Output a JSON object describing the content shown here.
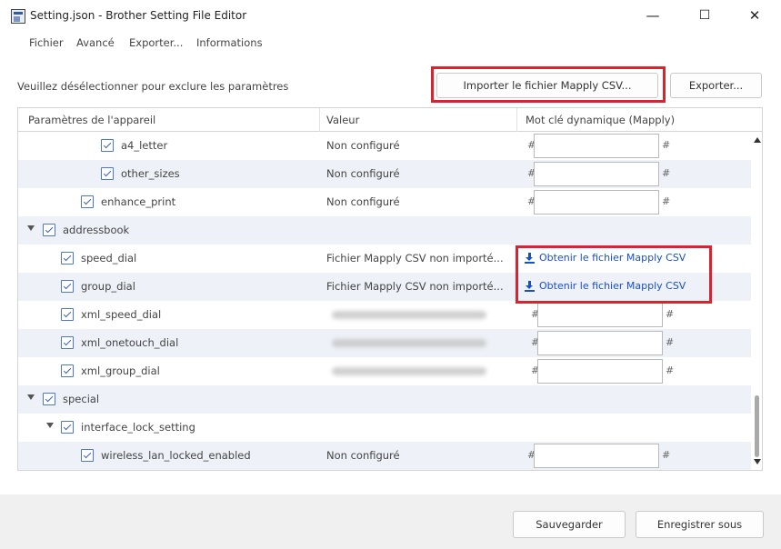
{
  "window": {
    "title": "Setting.json - Brother Setting File Editor",
    "minimize_glyph": "—",
    "maximize_glyph": "☐",
    "close_glyph": "✕"
  },
  "menu": [
    {
      "label": "Fichier"
    },
    {
      "label": "Avancé"
    },
    {
      "label": "Exporter..."
    },
    {
      "label": "Informations"
    }
  ],
  "toolbar": {
    "instruction": "Veuillez désélectionner pour exclure les paramètres",
    "import_label": "Importer le fichier Mapply CSV...",
    "export_label": "Exporter..."
  },
  "table": {
    "headers": {
      "param": "Paramètres de l'appareil",
      "value": "Valeur",
      "keyword": "Mot clé dynamique (Mapply)"
    },
    "hash": "#",
    "rows": [
      {
        "name": "a4_letter",
        "value": "Non configuré",
        "keyword": "",
        "level": 3,
        "checked": true,
        "type": "input"
      },
      {
        "name": "other_sizes",
        "value": "Non configuré",
        "keyword": "",
        "level": 3,
        "checked": true,
        "type": "input"
      },
      {
        "name": "enhance_print",
        "value": "Non configuré",
        "keyword": "",
        "level": 2,
        "checked": true,
        "type": "input"
      },
      {
        "name": "addressbook",
        "value": "",
        "level": 0,
        "checked": true,
        "type": "group",
        "expanded": true
      },
      {
        "name": "speed_dial",
        "value": "Fichier Mapply CSV non importé...",
        "link": "Obtenir le fichier Mapply CSV",
        "level": 1,
        "checked": true,
        "type": "link"
      },
      {
        "name": "group_dial",
        "value": "Fichier Mapply CSV non importé...",
        "link": "Obtenir le fichier Mapply CSV",
        "level": 1,
        "checked": true,
        "type": "link"
      },
      {
        "name": "xml_speed_dial",
        "value": "",
        "keyword": "",
        "level": 1,
        "checked": true,
        "type": "input",
        "blurred": true
      },
      {
        "name": "xml_onetouch_dial",
        "value": "",
        "keyword": "",
        "level": 1,
        "checked": true,
        "type": "input",
        "blurred": true
      },
      {
        "name": "xml_group_dial",
        "value": "",
        "keyword": "",
        "level": 1,
        "checked": true,
        "type": "input",
        "blurred": true
      },
      {
        "name": "special",
        "value": "",
        "level": 0,
        "checked": true,
        "type": "group",
        "expanded": true
      },
      {
        "name": "interface_lock_setting",
        "value": "",
        "level": 1,
        "checked": true,
        "type": "group",
        "expanded": true
      },
      {
        "name": "wireless_lan_locked_enabled",
        "value": "Non configuré",
        "keyword": "",
        "level": 2,
        "checked": true,
        "type": "input"
      }
    ]
  },
  "footer": {
    "save_label": "Sauvegarder",
    "save_as_label": "Enregistrer sous"
  },
  "colors": {
    "highlight": "#d9232f",
    "link": "#1b4fc4",
    "checkbox": "#4d78c9",
    "alt_row": "#eef1f8"
  }
}
